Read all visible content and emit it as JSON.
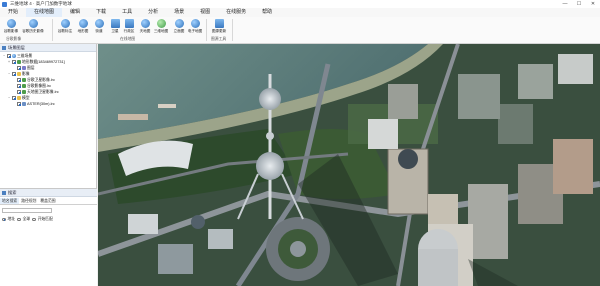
{
  "window": {
    "title": "三维地球 4 · 高户门加数字地球",
    "controls": [
      "—",
      "☐",
      "✕"
    ]
  },
  "menu": {
    "items": [
      "开始",
      "在线地图",
      "编辑",
      "下载",
      "工具",
      "分析",
      "场景",
      "视图",
      "在线服务",
      "帮助"
    ],
    "active_index": 1
  },
  "ribbon": {
    "groups": [
      {
        "label": "谷歌影像",
        "buttons": [
          "谷歌影像",
          "谷歌历史影像"
        ]
      },
      {
        "label": "在线地图",
        "buttons": [
          "谷歌标注",
          "地形图",
          "街道",
          "卫星",
          "行政区",
          "天地图",
          "三维地图",
          "立面图",
          "电子地图"
        ]
      },
      {
        "label": "图源工具",
        "buttons": [
          "图源更新"
        ]
      }
    ]
  },
  "layers_panel": {
    "title": "场景图层",
    "tree": [
      {
        "label": "三维场景",
        "depth": 0,
        "expanded": true,
        "checked": true,
        "icon": "globe-icon"
      },
      {
        "label": "地形数据[183469972731]",
        "depth": 1,
        "expanded": false,
        "checked": true,
        "icon": "image-icon"
      },
      {
        "label": "图层",
        "depth": 2,
        "expanded": false,
        "checked": true,
        "icon": "layer-icon"
      },
      {
        "label": "影像",
        "depth": 1,
        "expanded": true,
        "checked": true,
        "icon": "folder-icon"
      },
      {
        "label": "谷歌卫星影像.lrc",
        "depth": 2,
        "expanded": false,
        "checked": true,
        "icon": "image-icon"
      },
      {
        "label": "谷歌影像图.lrc",
        "depth": 2,
        "expanded": false,
        "checked": true,
        "icon": "image-icon"
      },
      {
        "label": "天地图卫星影像.lrc",
        "depth": 2,
        "expanded": false,
        "checked": true,
        "icon": "image-icon"
      },
      {
        "label": "模型",
        "depth": 1,
        "expanded": true,
        "checked": true,
        "icon": "folder-icon"
      },
      {
        "label": "ASTER(30m).lrc",
        "depth": 2,
        "expanded": false,
        "checked": true,
        "icon": "dom-icon"
      }
    ]
  },
  "search_panel": {
    "title": "搜索",
    "tabs": [
      "地名搜索",
      "路径规划",
      "覆盖范围"
    ],
    "active_tab": 0,
    "input_placeholder": "",
    "options": [
      {
        "label": "地址",
        "selected": true
      },
      {
        "label": "全球",
        "selected": false
      },
      {
        "label": "开始匹配",
        "selected": false
      }
    ]
  }
}
